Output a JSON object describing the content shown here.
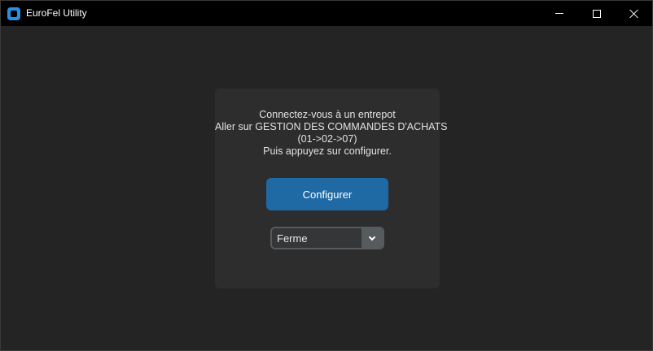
{
  "window": {
    "title": "EuroFel Utility",
    "controls": [
      "minimize",
      "maximize",
      "close"
    ]
  },
  "panel": {
    "instructions": [
      "Connectez-vous à un entrepot",
      "Aller sur GESTION DES COMMANDES D'ACHATS",
      "(01->02->07)",
      "Puis appuyez sur configurer."
    ],
    "configure_label": "Configurer",
    "dropdown": {
      "selected": "Ferme"
    }
  },
  "colors": {
    "background": "#242424",
    "panel": "#2d2d2d",
    "accent_button": "#1f6aa5",
    "titlebar": "#000000",
    "app_icon": "#2b8ee0"
  },
  "icons": {
    "app": "app-logo-icon",
    "dropdown": "chevron-down-icon"
  }
}
